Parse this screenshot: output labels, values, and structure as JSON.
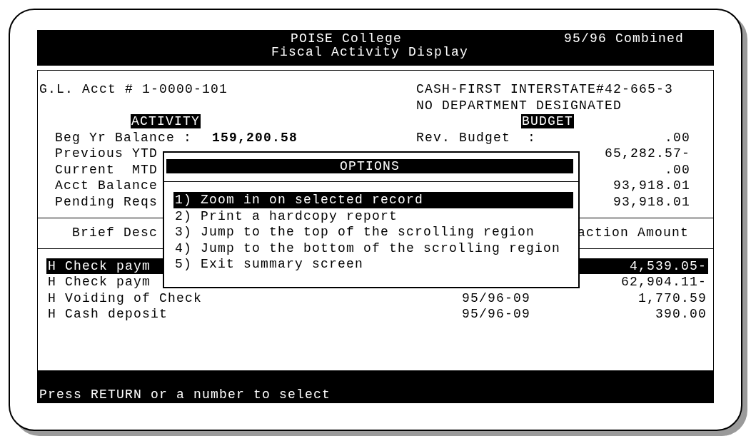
{
  "header": {
    "title": "POISE College",
    "period": "95/96 Combined",
    "subtitle": "Fiscal Activity Display"
  },
  "account": {
    "number": "G.L. Acct # 1-0000-101",
    "description": [
      "CASH-FIRST INTERSTATE#42-665-3",
      "NO DEPARTMENT DESIGNATED"
    ]
  },
  "activity": {
    "heading": "ACTIVITY",
    "rows": [
      {
        "label": "Beg Yr Balance :",
        "value": "159,200.58"
      },
      {
        "label": "Previous YTD"
      },
      {
        "label": "Current  MTD"
      },
      {
        "label": "Acct Balance"
      },
      {
        "label": "Pending Reqs"
      }
    ]
  },
  "budget": {
    "heading": "BUDGET",
    "rows": [
      {
        "label": "Rev. Budget  :",
        "value": ".00"
      },
      {
        "value": "65,282.57-"
      },
      {
        "value": ".00"
      },
      {
        "value": "93,918.01"
      },
      {
        "value": "93,918.01"
      }
    ]
  },
  "table": {
    "columns": [
      "Brief Desc",
      "action Amount"
    ],
    "rows": [
      {
        "description": "H Check paym",
        "amount": "4,539.05-",
        "selected": true
      },
      {
        "description": "H Check paym",
        "amount": "62,904.11-",
        "selected": false
      },
      {
        "description": "H Voiding of Check",
        "period": "95/96-09",
        "amount": "1,770.59",
        "selected": false
      },
      {
        "description": "H Cash deposit",
        "period": "95/96-09",
        "amount": "390.00",
        "selected": false
      }
    ]
  },
  "options": {
    "title": "OPTIONS",
    "items": [
      {
        "label": "1) Zoom in on selected record",
        "selected": true
      },
      {
        "label": "2) Print a hardcopy report",
        "selected": false
      },
      {
        "label": "3) Jump to the top of the scrolling region",
        "selected": false
      },
      {
        "label": "4) Jump to the bottom of the scrolling region",
        "selected": false
      },
      {
        "label": "5) Exit summary screen",
        "selected": false
      }
    ]
  },
  "status_bar": "Press RETURN or a number to select"
}
